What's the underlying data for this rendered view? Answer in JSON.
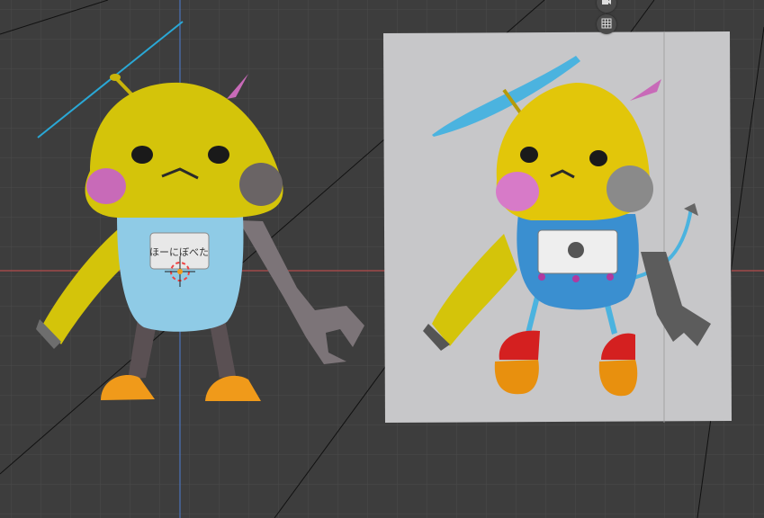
{
  "viewport": {
    "background": "#3d3d3d",
    "grid_color": "#4a4a4a",
    "x_axis_color": "#b44b4b",
    "y_axis_color": "#4a6fb0"
  },
  "model": {
    "shirt_label": "ほーにぼべた",
    "body_color": "#d4c40a",
    "shirt_color": "#8fcbe6",
    "foot_color": "#f09a1a",
    "cheek_color": "#c86ab8"
  },
  "reference": {
    "background": "#c7c7c9"
  },
  "overlays": {
    "camera_icon": "camera-icon",
    "grid_icon": "grid-icon"
  }
}
